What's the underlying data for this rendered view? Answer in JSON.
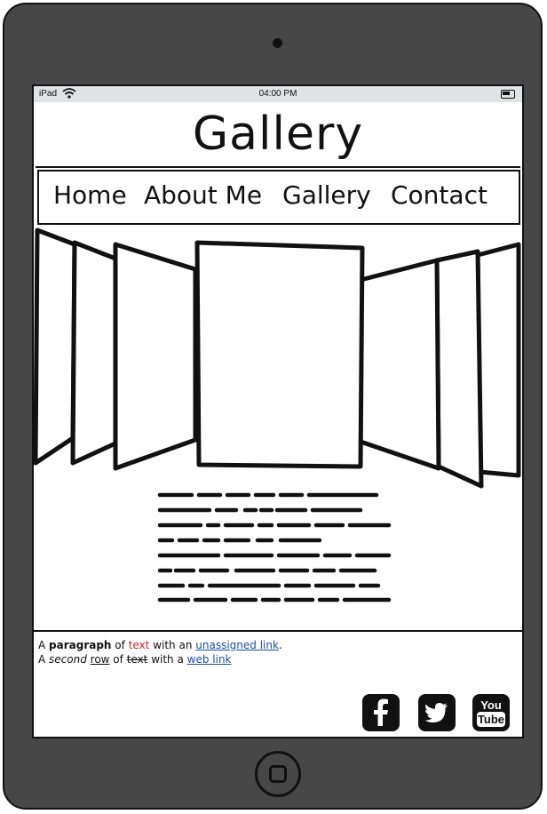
{
  "statusbar": {
    "device": "iPad",
    "time": "04:00 PM"
  },
  "header": {
    "title": "Gallery"
  },
  "nav": {
    "items": [
      "Home",
      "About Me",
      "Gallery",
      "Contact"
    ]
  },
  "footer": {
    "p1": {
      "a": "A ",
      "bold": "paragraph",
      "b": " of ",
      "red": "text",
      "c": " with an ",
      "link": "unassigned link",
      "d": "."
    },
    "p2": {
      "a": "A ",
      "italic": "second",
      "b": " ",
      "underline": "row",
      "c": " of ",
      "strike": "text",
      "d": " with a ",
      "link": "web link"
    }
  },
  "social": [
    "facebook-icon",
    "twitter-icon",
    "youtube-icon"
  ],
  "colors": {
    "frame": "#474747",
    "statusbar": "#dfe3e4",
    "accent_red": "#d02020",
    "link": "#1a4fa0"
  }
}
